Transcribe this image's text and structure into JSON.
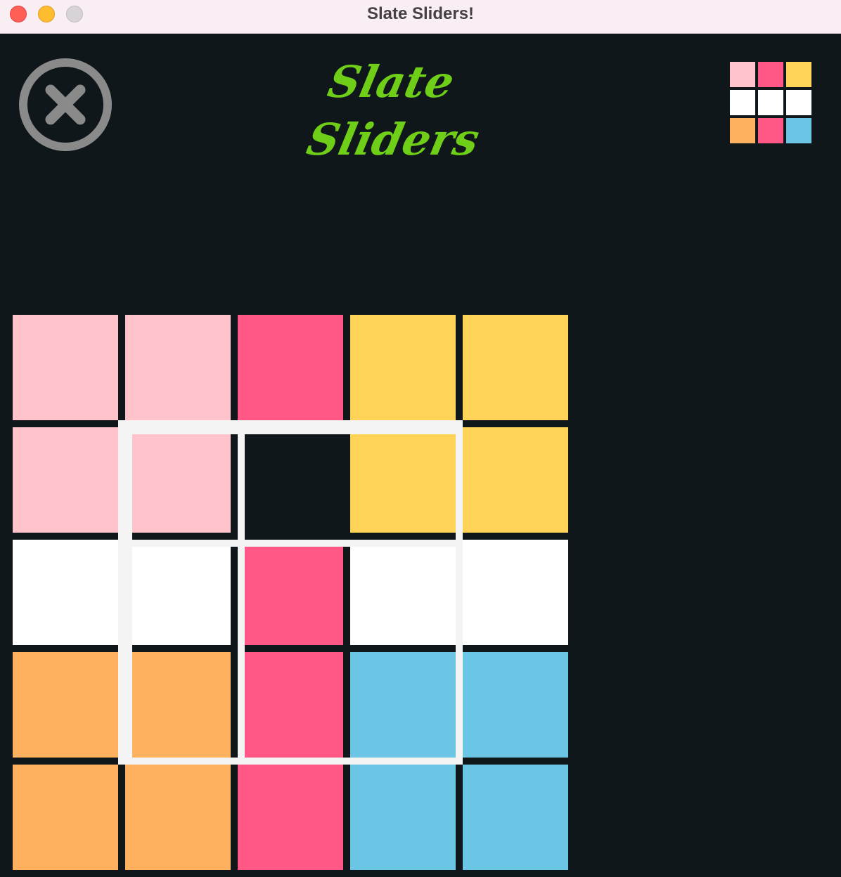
{
  "window": {
    "title": "Slate Sliders!"
  },
  "game": {
    "title_line_1": "Slate",
    "title_line_2": "Sliders",
    "exit_icon": "close-circle-icon",
    "colors": {
      "P": "#ffc3cb",
      "M": "#ff5786",
      "Y": "#ffd258",
      "W": "#ffffff",
      "O": "#ffb160",
      "B": "#6bc5e5",
      "E": "#10171b",
      "background": "#10171b",
      "title": "#6fcf18",
      "exit_icon": "#8a8a8a",
      "frame": "#f4f4f4"
    },
    "target_pattern": [
      [
        "P",
        "M",
        "Y"
      ],
      [
        "W",
        "W",
        "W"
      ],
      [
        "O",
        "M",
        "B"
      ]
    ],
    "board": [
      [
        "P",
        "P",
        "M",
        "Y",
        "Y"
      ],
      [
        "P",
        "P",
        "E",
        "Y",
        "Y"
      ],
      [
        "W",
        "W",
        "M",
        "W",
        "W"
      ],
      [
        "O",
        "O",
        "M",
        "B",
        "B"
      ],
      [
        "O",
        "O",
        "M",
        "B",
        "B"
      ]
    ]
  }
}
